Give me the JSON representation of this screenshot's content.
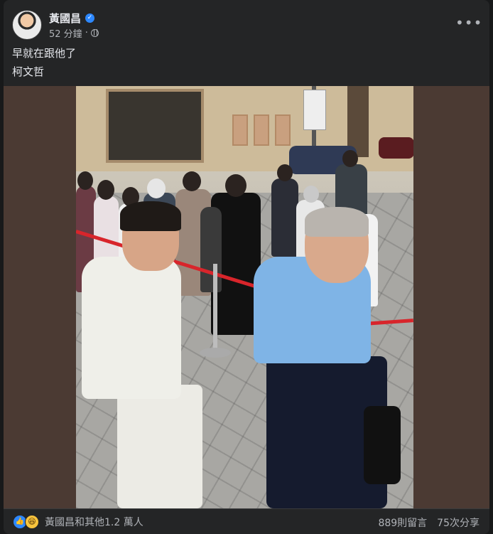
{
  "post": {
    "author": "黃國昌",
    "time": "52 分鐘",
    "separator": "·",
    "text_lines": [
      "早就在跟他了",
      "柯文哲"
    ]
  },
  "icons": {
    "avatar": "avatar",
    "verified": "verified-badge-icon",
    "globe": "globe-icon",
    "more": "more-options-icon",
    "like": "like-reaction-icon",
    "haha": "haha-reaction-icon"
  },
  "footer": {
    "reactions_text": "黃國昌和其他1.2 萬人",
    "comments": "889則留言",
    "shares": "75次分享"
  },
  "colors": {
    "background": "#18191a",
    "card": "#242526",
    "accent": "#2d88ff",
    "text_primary": "#e4e6eb",
    "text_secondary": "#b0b3b8"
  }
}
